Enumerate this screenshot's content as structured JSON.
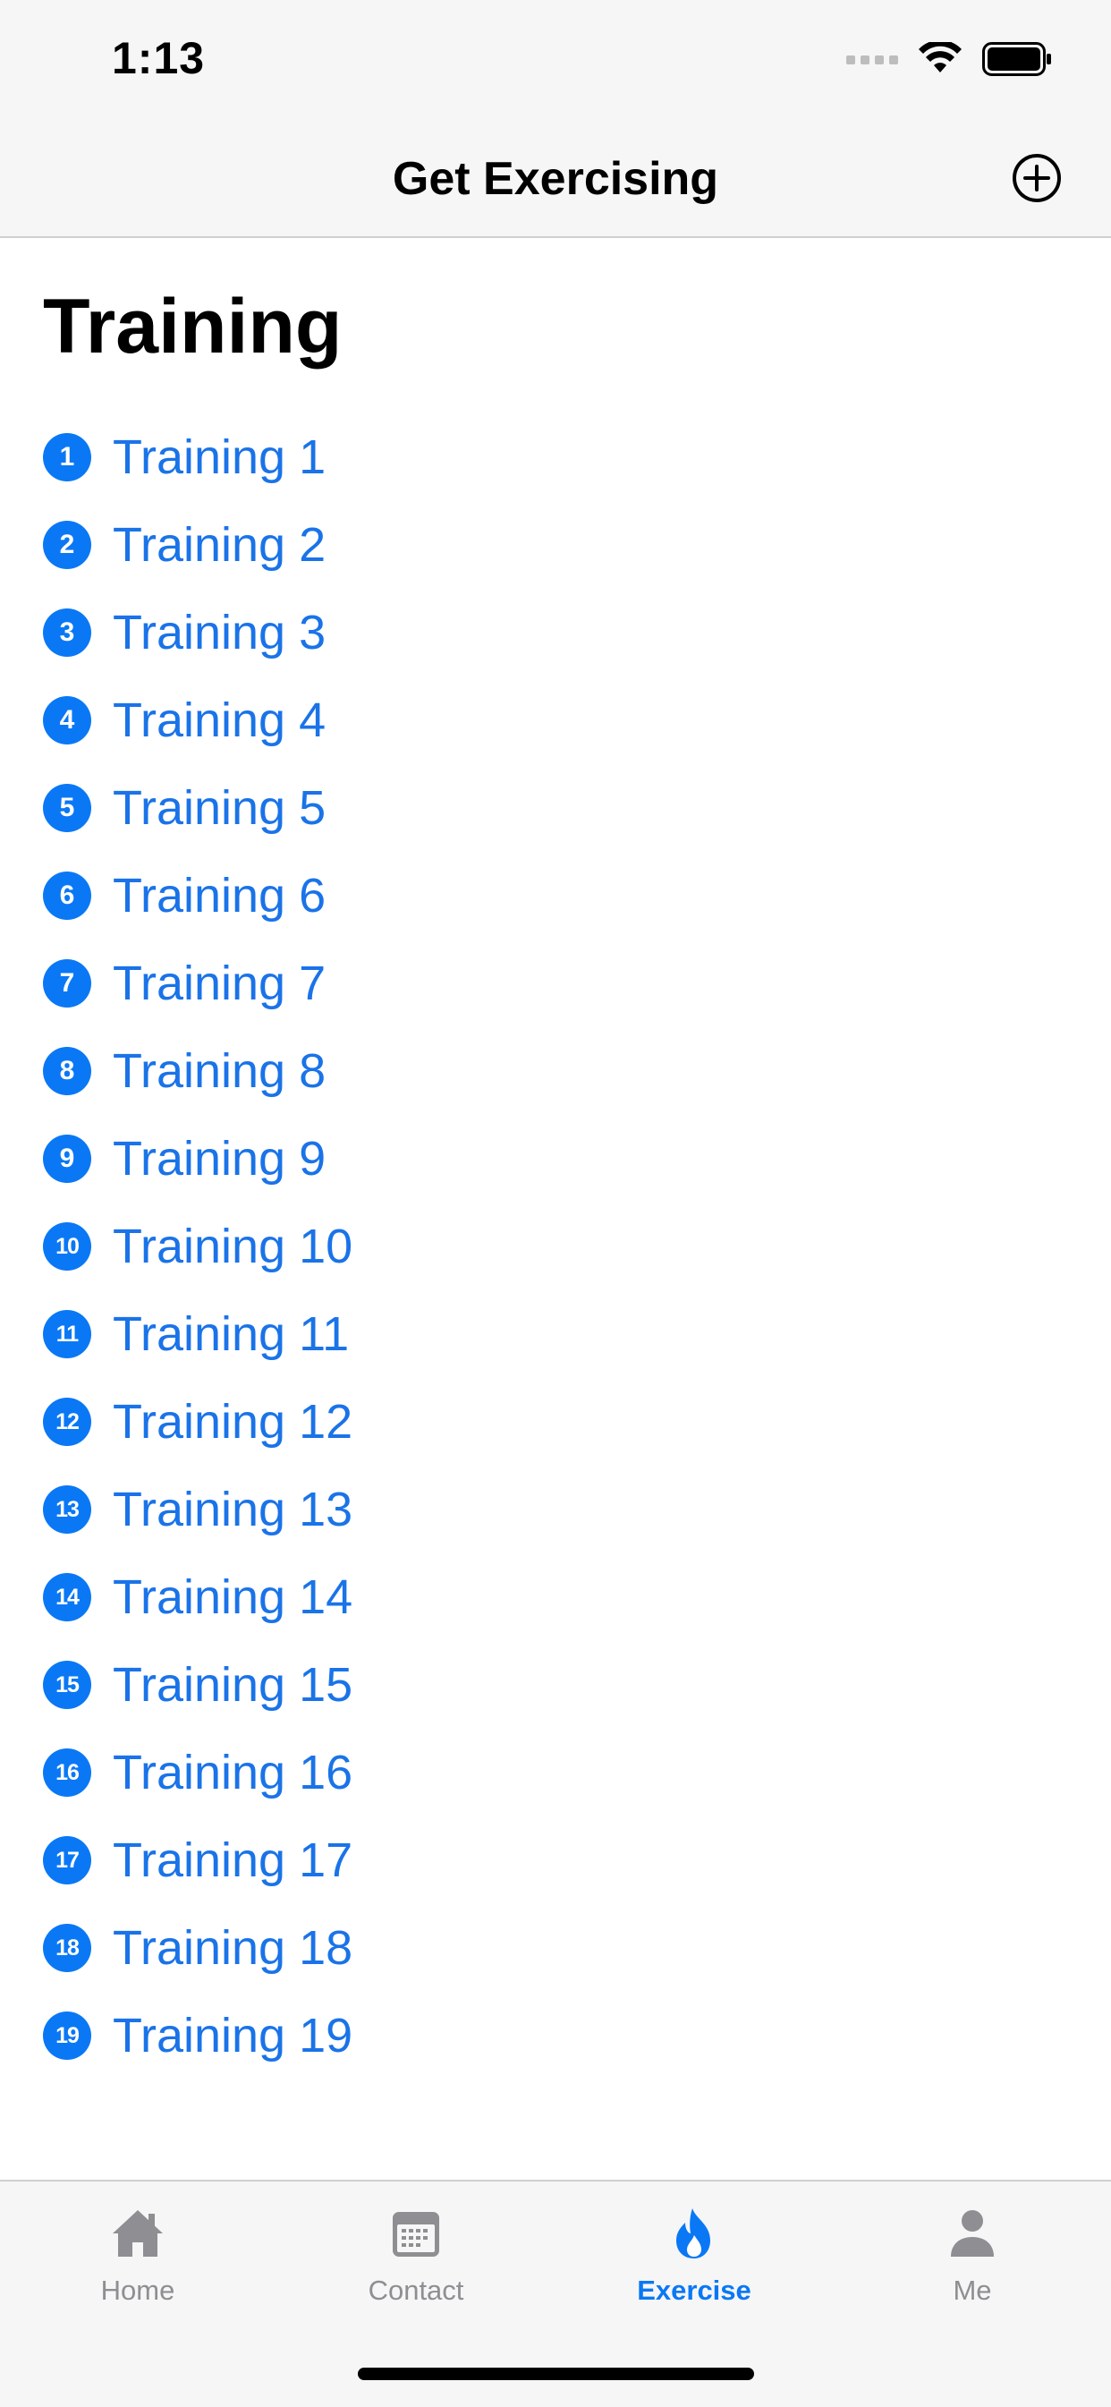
{
  "status": {
    "time": "1:13"
  },
  "nav": {
    "title": "Get Exercising",
    "add_icon": "plus-circle-icon"
  },
  "section": {
    "title": "Training"
  },
  "trainings": [
    {
      "num": "1",
      "label": "Training 1"
    },
    {
      "num": "2",
      "label": "Training 2"
    },
    {
      "num": "3",
      "label": "Training 3"
    },
    {
      "num": "4",
      "label": "Training 4"
    },
    {
      "num": "5",
      "label": "Training 5"
    },
    {
      "num": "6",
      "label": "Training 6"
    },
    {
      "num": "7",
      "label": "Training 7"
    },
    {
      "num": "8",
      "label": "Training 8"
    },
    {
      "num": "9",
      "label": "Training 9"
    },
    {
      "num": "10",
      "label": "Training 10"
    },
    {
      "num": "11",
      "label": "Training 11"
    },
    {
      "num": "12",
      "label": "Training 12"
    },
    {
      "num": "13",
      "label": "Training 13"
    },
    {
      "num": "14",
      "label": "Training 14"
    },
    {
      "num": "15",
      "label": "Training 15"
    },
    {
      "num": "16",
      "label": "Training 16"
    },
    {
      "num": "17",
      "label": "Training 17"
    },
    {
      "num": "18",
      "label": "Training 18"
    },
    {
      "num": "19",
      "label": "Training 19"
    }
  ],
  "tabs": [
    {
      "label": "Home",
      "icon": "house-icon",
      "active": false
    },
    {
      "label": "Contact",
      "icon": "calendar-icon",
      "active": false
    },
    {
      "label": "Exercise",
      "icon": "flame-icon",
      "active": true
    },
    {
      "label": "Me",
      "icon": "person-icon",
      "active": false
    }
  ],
  "colors": {
    "accent": "#0a78f5",
    "link": "#1a73e8",
    "inactive": "#8e8e93"
  }
}
